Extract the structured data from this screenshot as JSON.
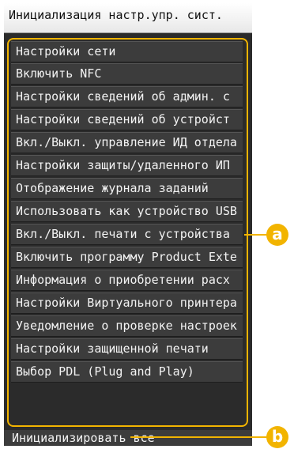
{
  "title": "Инициализация настр.упр. сист.",
  "items": [
    "Настройки сети",
    "Включить NFC",
    "Настройки сведений об админ. с",
    "Настройки сведений об устройст",
    "Вкл./Выкл. управление ИД отдела",
    "Настройки защиты/удаленного ИП",
    "Отображение журнала заданий",
    "Использовать как устройство USB",
    "Вкл./Выкл. печати с устройства",
    "Включить программу Product Exte",
    "Информация о приобретении расх",
    "Настройки Виртуального принтера",
    "Уведомление о проверке настроек",
    "Настройки защищенной печати",
    "Выбор PDL (Plug and Play)"
  ],
  "footer": "Инициализировать все",
  "callouts": {
    "a": "a",
    "b": "b"
  },
  "colors": {
    "accent": "#f2b400",
    "panel": "#2b2b2b",
    "item": "#3c3c3c"
  }
}
